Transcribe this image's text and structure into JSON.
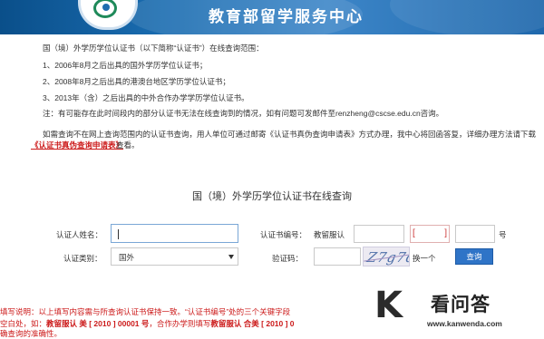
{
  "header": {
    "title": "教育部留学服务中心"
  },
  "intro": {
    "scope_title": "国（境）外学历学位认证书（以下简称“认证书”）在线查询范围：",
    "scope_items": [
      "1、2006年8月之后出具的国外学历学位认证书；",
      "2、2008年8月之后出具的港澳台地区学历学位认证书；",
      "3、2013年（含）之后出具的中外合作办学学历学位认证书。"
    ],
    "note": "注：有可能存在此时间段内的部分认证书无法在线查询到的情况，如有问题可发邮件至renzheng@cscse.edu.cn咨询。",
    "offline_text": "如需查询不在网上查询范围内的认证书查询，用人单位可通过邮寄《认证书真伪查询申请表》方式办理，我中心将回函答复，详细办理方法请下载",
    "offline_link": "《认证书真伪查询申请表》",
    "offline_tail": "查看。"
  },
  "form": {
    "title": "国（境）外学历学位认证书在线查询",
    "name_label": "认证人姓名：",
    "name_value": "",
    "cert_no_label": "认证书编号：",
    "cert_prefix": "教留服认",
    "open_paren": "[",
    "close_paren": "]",
    "cert_suffix": "号",
    "type_label": "认证类别：",
    "type_value": "国外",
    "captcha_label": "验证码：",
    "captcha_value": "",
    "captcha_code": "Z7g7d8",
    "refresh_label": "换一个",
    "search_button": "查询"
  },
  "help": {
    "line1": "填写说明：以上填写内容需与所查询认证书保持一致。“认证书编号”处的三个关键字段",
    "line2_a": "空白处，如：",
    "line2_b": "教留服认 美 [ 2010 ] 00001 号",
    "line2_c": "，合作办学则填写",
    "line2_d": "教留服认 合美 [ 2010 ] 0",
    "line3": "确查询的准确性。"
  },
  "watermark": {
    "logo_letter": "K",
    "title": "看问答",
    "url": "www.kanwenda.com"
  }
}
